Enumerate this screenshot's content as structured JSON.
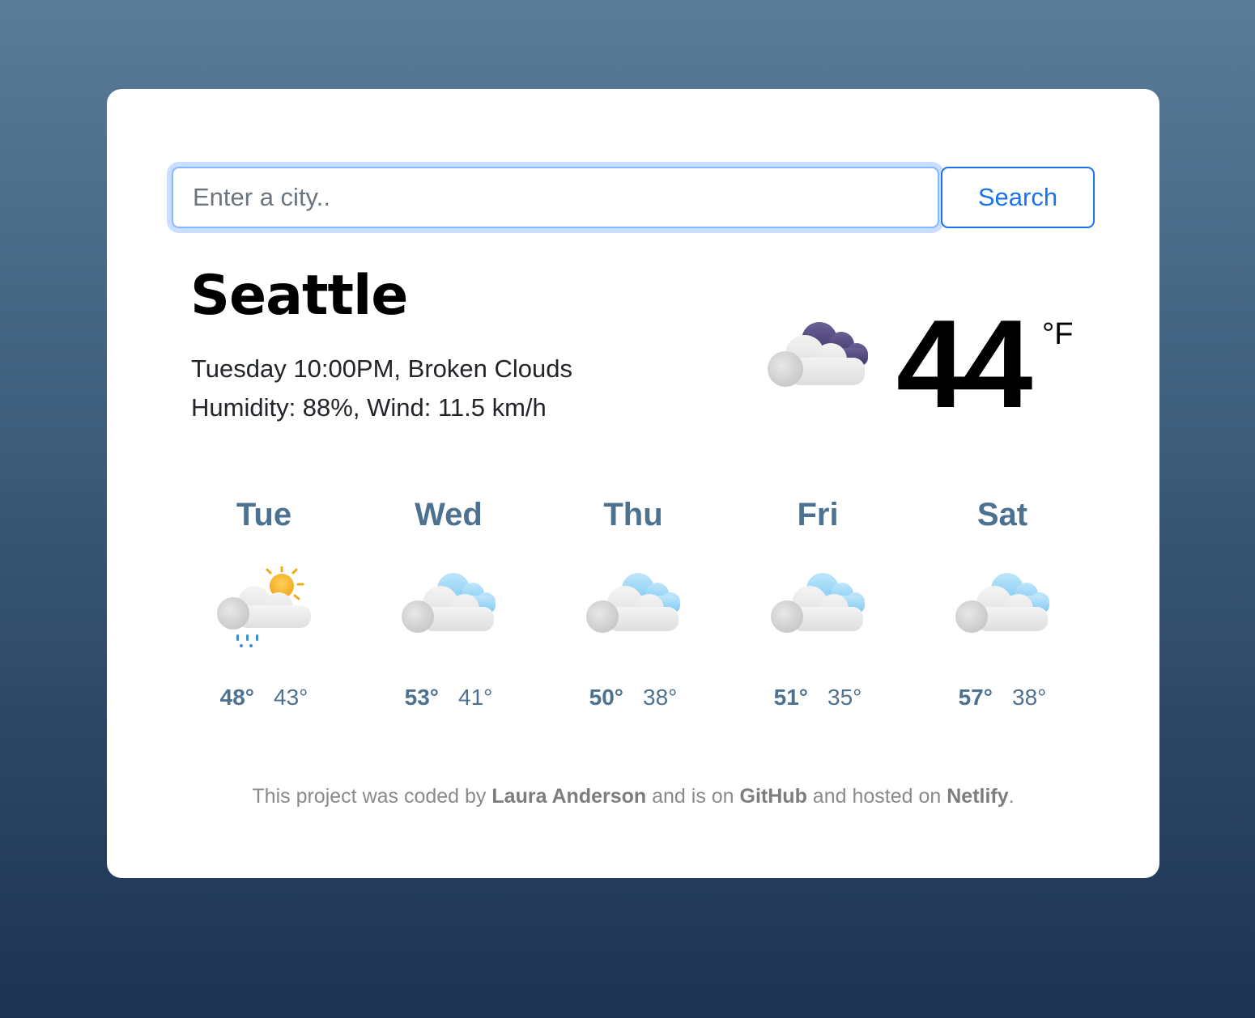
{
  "search": {
    "placeholder": "Enter a city..",
    "value": "",
    "button_label": "Search"
  },
  "current": {
    "city": "Seattle",
    "description_line": "Tuesday 10:00PM, Broken Clouds",
    "humidity_wind_line": "Humidity: 88%, Wind: 11.5 km/h",
    "temperature": "44",
    "unit": "°F",
    "icon": "broken-clouds-night-icon"
  },
  "forecast": [
    {
      "day": "Tue",
      "high": "48°",
      "low": "43°",
      "icon": "rain-sun-icon"
    },
    {
      "day": "Wed",
      "high": "53°",
      "low": "41°",
      "icon": "broken-clouds-icon"
    },
    {
      "day": "Thu",
      "high": "50°",
      "low": "38°",
      "icon": "broken-clouds-icon"
    },
    {
      "day": "Fri",
      "high": "51°",
      "low": "35°",
      "icon": "broken-clouds-icon"
    },
    {
      "day": "Sat",
      "high": "57°",
      "low": "38°",
      "icon": "broken-clouds-icon"
    }
  ],
  "footer": {
    "prefix": "This project was coded by ",
    "author": "Laura Anderson",
    "middle1": " and is on ",
    "github": "GitHub",
    "middle2": " and hosted on ",
    "netlify": "Netlify",
    "suffix": "."
  },
  "colors": {
    "accent": "#1a73e8",
    "forecast_text": "#4d7291",
    "footer_text": "#8a8a8a"
  }
}
